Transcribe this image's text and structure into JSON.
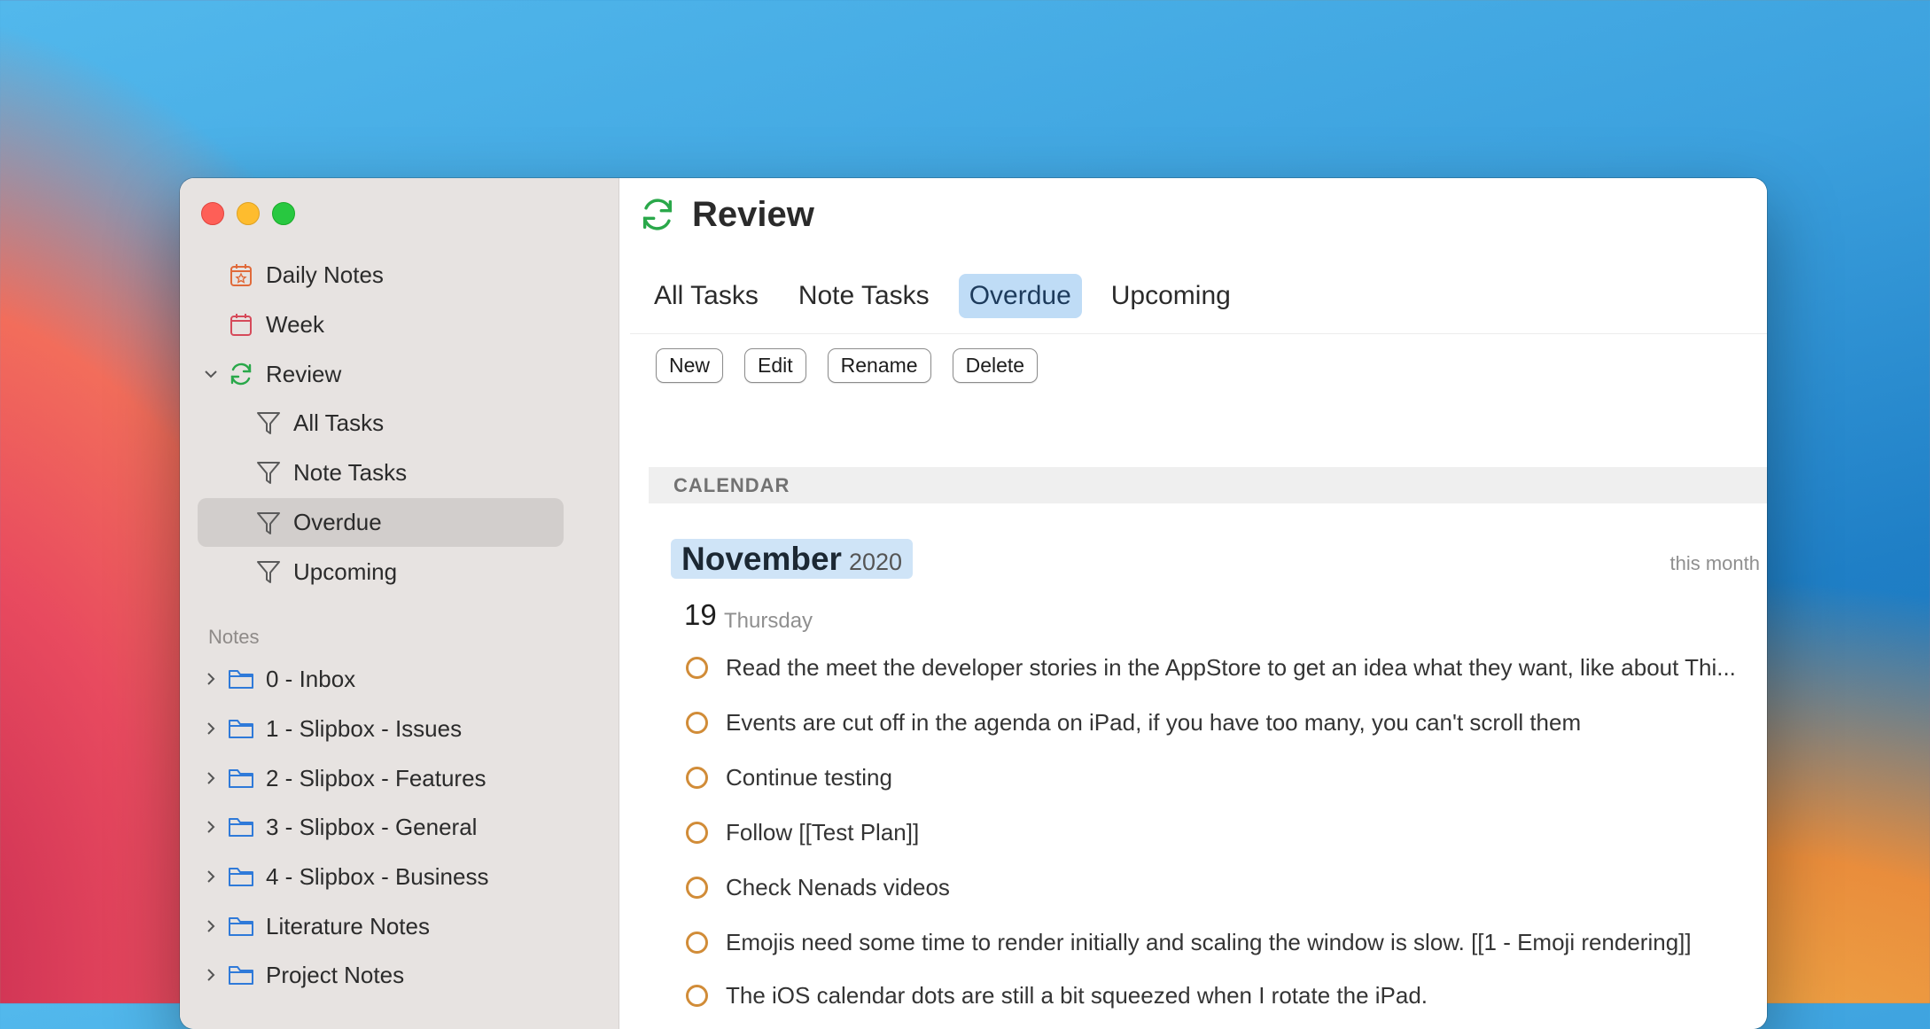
{
  "sidebar": {
    "items": [
      {
        "label": "Daily Notes",
        "icon": "calendar-star-icon"
      },
      {
        "label": "Week",
        "icon": "calendar-icon"
      },
      {
        "label": "Review",
        "icon": "refresh-icon"
      },
      {
        "label": "All Tasks",
        "icon": "filter-icon"
      },
      {
        "label": "Note Tasks",
        "icon": "filter-icon"
      },
      {
        "label": "Overdue",
        "icon": "filter-icon"
      },
      {
        "label": "Upcoming",
        "icon": "filter-icon"
      }
    ],
    "notes_section_label": "Notes",
    "folders": [
      {
        "label": "0 - Inbox"
      },
      {
        "label": "1 - Slipbox - Issues"
      },
      {
        "label": "2 - Slipbox - Features"
      },
      {
        "label": "3 - Slipbox - General"
      },
      {
        "label": "4 - Slipbox - Business"
      },
      {
        "label": "Literature Notes"
      },
      {
        "label": "Project Notes"
      }
    ]
  },
  "main": {
    "title": "Review",
    "tabs": [
      {
        "label": "All Tasks"
      },
      {
        "label": "Note Tasks"
      },
      {
        "label": "Overdue",
        "active": true
      },
      {
        "label": "Upcoming"
      }
    ],
    "buttons": {
      "new": "New",
      "edit": "Edit",
      "rename": "Rename",
      "delete": "Delete"
    },
    "calendar_label": "CALENDAR",
    "month": {
      "name": "November",
      "year": "2020",
      "relative": "this month"
    },
    "day": {
      "number": "19",
      "name": "Thursday"
    },
    "tasks": [
      {
        "text": "Read the meet the developer stories in the AppStore to get an idea what they want, like about Thi..."
      },
      {
        "text": "Events are cut off in the agenda on iPad, if you have too many, you can't scroll them"
      },
      {
        "text": "Continue testing"
      },
      {
        "text": "Follow [[Test Plan]]"
      },
      {
        "text": "Check Nenads videos"
      },
      {
        "text": "Emojis need some time to render initially and scaling the window is slow. [[1 - Emoji rendering]]"
      },
      {
        "text": "The iOS calendar dots are still a bit squeezed when I rotate the iPad."
      }
    ]
  },
  "colors": {
    "accent_selected_tab": "#bfdcf6",
    "task_circle": "#d18c38",
    "review_icon": "#2aa84a",
    "folder_icon": "#2f7ad9",
    "calendar_icon": "#e06a3a"
  }
}
